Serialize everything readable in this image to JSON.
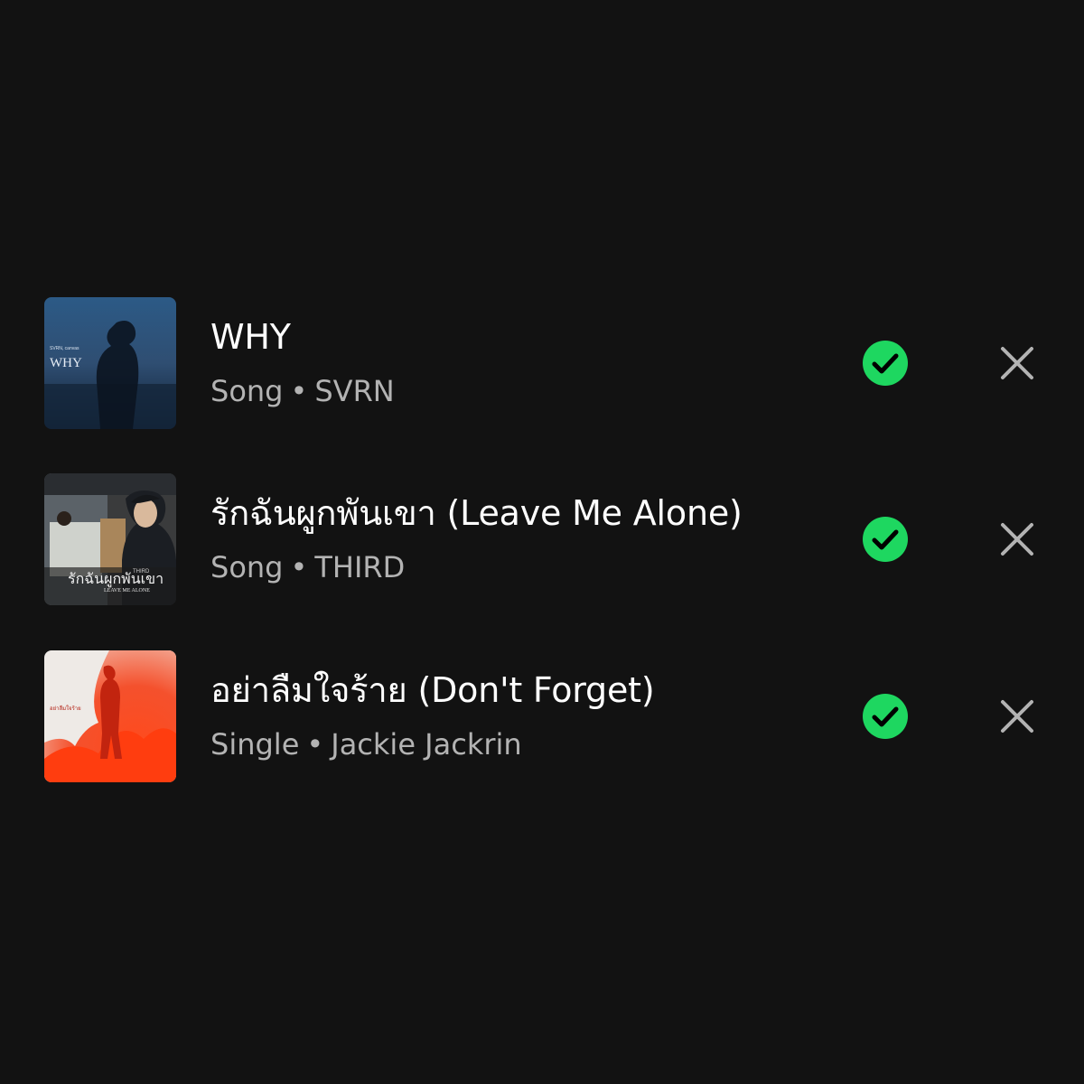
{
  "colors": {
    "background": "#121212",
    "title": "#ffffff",
    "subtitle": "#b3b3b3",
    "check_green": "#1ed760",
    "remove_gray": "#b3b3b3"
  },
  "items": [
    {
      "title": "WHY",
      "type": "Song",
      "separator": "•",
      "artist": "SVRN",
      "added": true,
      "cover_text": [
        "SVRN, canvas",
        "WHY"
      ]
    },
    {
      "title": "รักฉันผูกพันเขา (Leave Me Alone)",
      "type": "Song",
      "separator": "•",
      "artist": "THIRD",
      "added": true,
      "cover_text": [
        "รักฉันผูกพันเขา",
        "LEAVE ME ALONE",
        "THIRD"
      ]
    },
    {
      "title": "อย่าลืมใจร้าย (Don't Forget)",
      "type": "Single",
      "separator": "•",
      "artist": "Jackie Jackrin",
      "added": true,
      "cover_text": [
        "อย่าลืมใจร้าย"
      ]
    }
  ]
}
